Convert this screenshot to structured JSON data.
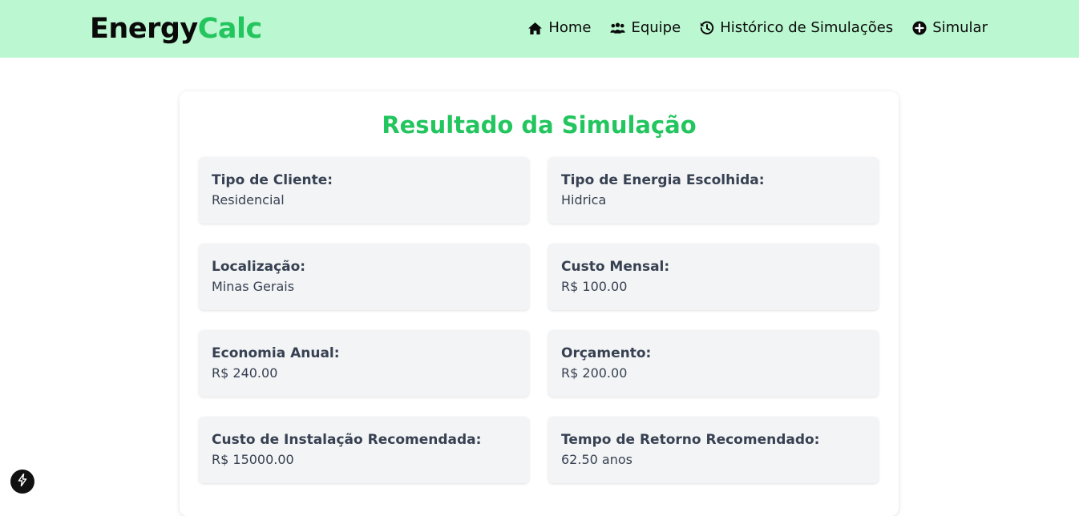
{
  "header": {
    "logo_part1": "Energy",
    "logo_part2": "Calc",
    "nav": [
      {
        "label": "Home",
        "icon": "home-icon"
      },
      {
        "label": "Equipe",
        "icon": "users-icon"
      },
      {
        "label": "Histórico de Simulações",
        "icon": "history-icon"
      },
      {
        "label": "Simular",
        "icon": "plus-circle-icon"
      }
    ]
  },
  "result": {
    "title": "Resultado da Simulação",
    "fields": [
      {
        "label": "Tipo de Cliente:",
        "value": "Residencial"
      },
      {
        "label": "Tipo de Energia Escolhida:",
        "value": "Hidrica"
      },
      {
        "label": "Localização:",
        "value": "Minas Gerais"
      },
      {
        "label": "Custo Mensal:",
        "value": "R$ 100.00"
      },
      {
        "label": "Economia Anual:",
        "value": "R$ 240.00"
      },
      {
        "label": "Orçamento:",
        "value": "R$ 200.00"
      },
      {
        "label": "Custo de Instalação Recomendada:",
        "value": "R$ 15000.00"
      },
      {
        "label": "Tempo de Retorno Recomendado:",
        "value": "62.50 anos"
      }
    ]
  },
  "colors": {
    "header_bg": "#bbf7d0",
    "accent": "#22c55e",
    "field_bg": "#f3f4f6",
    "text": "#374151"
  },
  "dev_badge": {
    "icon": "lightning-icon"
  }
}
